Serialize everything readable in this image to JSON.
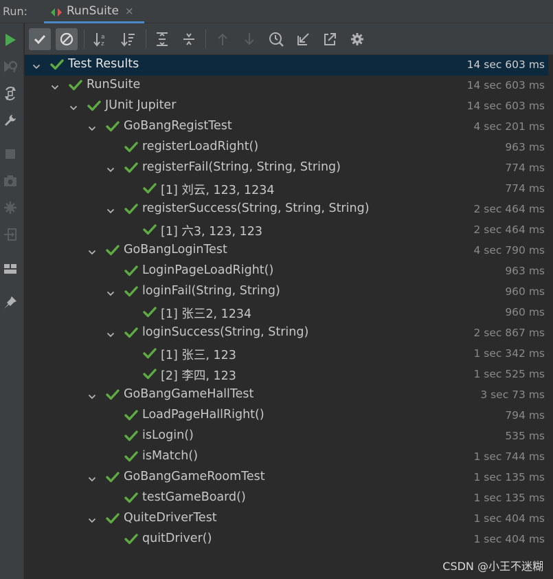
{
  "header": {
    "run_label": "Run:",
    "tab_label": "RunSuite",
    "tab_close": "×"
  },
  "sidebar_icons": [
    "rerun-icon",
    "rerun-failed-icon",
    "toggle-auto-test-icon",
    "wrench-icon",
    "stop-icon",
    "camera-icon",
    "coverage-icon",
    "exit-icon",
    "layout-icon",
    "pin-icon"
  ],
  "toolbar_icons": [
    "show-passed-icon",
    "show-ignored-icon",
    "sort-alphabetically-icon",
    "sort-by-duration-icon",
    "expand-all-icon",
    "collapse-all-icon",
    "previous-failed-icon",
    "next-failed-icon",
    "test-history-icon",
    "import-tests-icon",
    "export-tests-icon",
    "settings-icon"
  ],
  "colors": {
    "pass": "#5fab43",
    "selected": "#0d293e",
    "play": "#4aa94e"
  },
  "tree": [
    {
      "name": "Test Results",
      "time": "14 sec 603 ms",
      "depth": 0,
      "expandable": true,
      "selected": true
    },
    {
      "name": "RunSuite",
      "time": "14 sec 603 ms",
      "depth": 1,
      "expandable": true
    },
    {
      "name": "JUnit Jupiter",
      "time": "14 sec 603 ms",
      "depth": 2,
      "expandable": true
    },
    {
      "name": "GoBangRegistTest",
      "time": "4 sec 201 ms",
      "depth": 3,
      "expandable": true
    },
    {
      "name": "registerLoadRight()",
      "time": "963 ms",
      "depth": 4,
      "expandable": false
    },
    {
      "name": "registerFail(String, String, String)",
      "time": "774 ms",
      "depth": 4,
      "expandable": true
    },
    {
      "name": "[1] 刘云, 123, 1234",
      "time": "774 ms",
      "depth": 5,
      "expandable": false
    },
    {
      "name": "registerSuccess(String, String, String)",
      "time": "2 sec 464 ms",
      "depth": 4,
      "expandable": true
    },
    {
      "name": "[1] 六3, 123, 123",
      "time": "2 sec 464 ms",
      "depth": 5,
      "expandable": false
    },
    {
      "name": "GoBangLoginTest",
      "time": "4 sec 790 ms",
      "depth": 3,
      "expandable": true
    },
    {
      "name": "LoginPageLoadRight()",
      "time": "963 ms",
      "depth": 4,
      "expandable": false
    },
    {
      "name": "loginFail(String, String)",
      "time": "960 ms",
      "depth": 4,
      "expandable": true
    },
    {
      "name": "[1] 张三2, 1234",
      "time": "960 ms",
      "depth": 5,
      "expandable": false
    },
    {
      "name": "loginSuccess(String, String)",
      "time": "2 sec 867 ms",
      "depth": 4,
      "expandable": true
    },
    {
      "name": "[1] 张三, 123",
      "time": "1 sec 342 ms",
      "depth": 5,
      "expandable": false
    },
    {
      "name": "[2] 李四, 123",
      "time": "1 sec 525 ms",
      "depth": 5,
      "expandable": false
    },
    {
      "name": "GoBangGameHallTest",
      "time": "3 sec 73 ms",
      "depth": 3,
      "expandable": true
    },
    {
      "name": "LoadPageHallRight()",
      "time": "794 ms",
      "depth": 4,
      "expandable": false
    },
    {
      "name": "isLogin()",
      "time": "535 ms",
      "depth": 4,
      "expandable": false
    },
    {
      "name": "isMatch()",
      "time": "1 sec 744 ms",
      "depth": 4,
      "expandable": false
    },
    {
      "name": "GoBangGameRoomTest",
      "time": "1 sec 135 ms",
      "depth": 3,
      "expandable": true
    },
    {
      "name": "testGameBoard()",
      "time": "1 sec 135 ms",
      "depth": 4,
      "expandable": false
    },
    {
      "name": "QuiteDriverTest",
      "time": "1 sec 404 ms",
      "depth": 3,
      "expandable": true
    },
    {
      "name": "quitDriver()",
      "time": "1 sec 404 ms",
      "depth": 4,
      "expandable": false
    }
  ],
  "watermark": "CSDN @小王不迷糊"
}
